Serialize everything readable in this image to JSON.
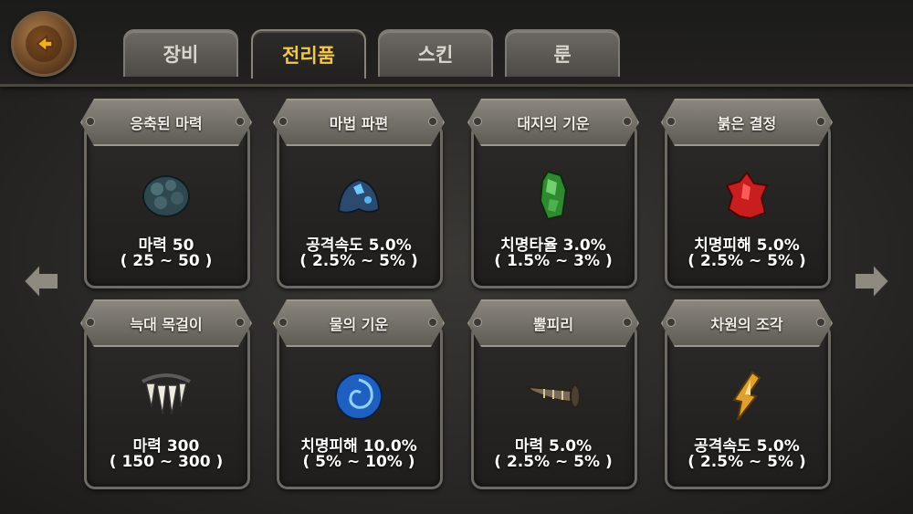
{
  "tabs": [
    {
      "label": "장비",
      "active": false
    },
    {
      "label": "전리품",
      "active": true
    },
    {
      "label": "스킨",
      "active": false
    },
    {
      "label": "룬",
      "active": false
    }
  ],
  "items": [
    {
      "name": "응축된 마력",
      "value": "마력 50",
      "range": "( 25 ~ 50 )",
      "icon": "dark-orb-icon"
    },
    {
      "name": "마법 파편",
      "value": "공격속도 5.0%",
      "range": "( 2.5% ~ 5% )",
      "icon": "magic-shard-icon"
    },
    {
      "name": "대지의 기운",
      "value": "치명타율 3.0%",
      "range": "( 1.5% ~ 3% )",
      "icon": "earth-crystal-icon"
    },
    {
      "name": "붉은 결정",
      "value": "치명피해 5.0%",
      "range": "( 2.5% ~ 5% )",
      "icon": "red-crystal-icon"
    },
    {
      "name": "늑대 목걸이",
      "value": "마력 300",
      "range": "( 150 ~ 300 )",
      "icon": "wolf-necklace-icon"
    },
    {
      "name": "물의 기운",
      "value": "치명피해 10.0%",
      "range": "( 5% ~ 10% )",
      "icon": "water-orb-icon"
    },
    {
      "name": "뿔피리",
      "value": "마력 5.0%",
      "range": "( 2.5% ~ 5% )",
      "icon": "horn-icon"
    },
    {
      "name": "차원의 조각",
      "value": "공격속도 5.0%",
      "range": "( 2.5% ~ 5% )",
      "icon": "dimension-shard-icon"
    }
  ],
  "colors": {
    "active_tab_text": "#f3c84a",
    "accent_back": "#f0b020"
  }
}
